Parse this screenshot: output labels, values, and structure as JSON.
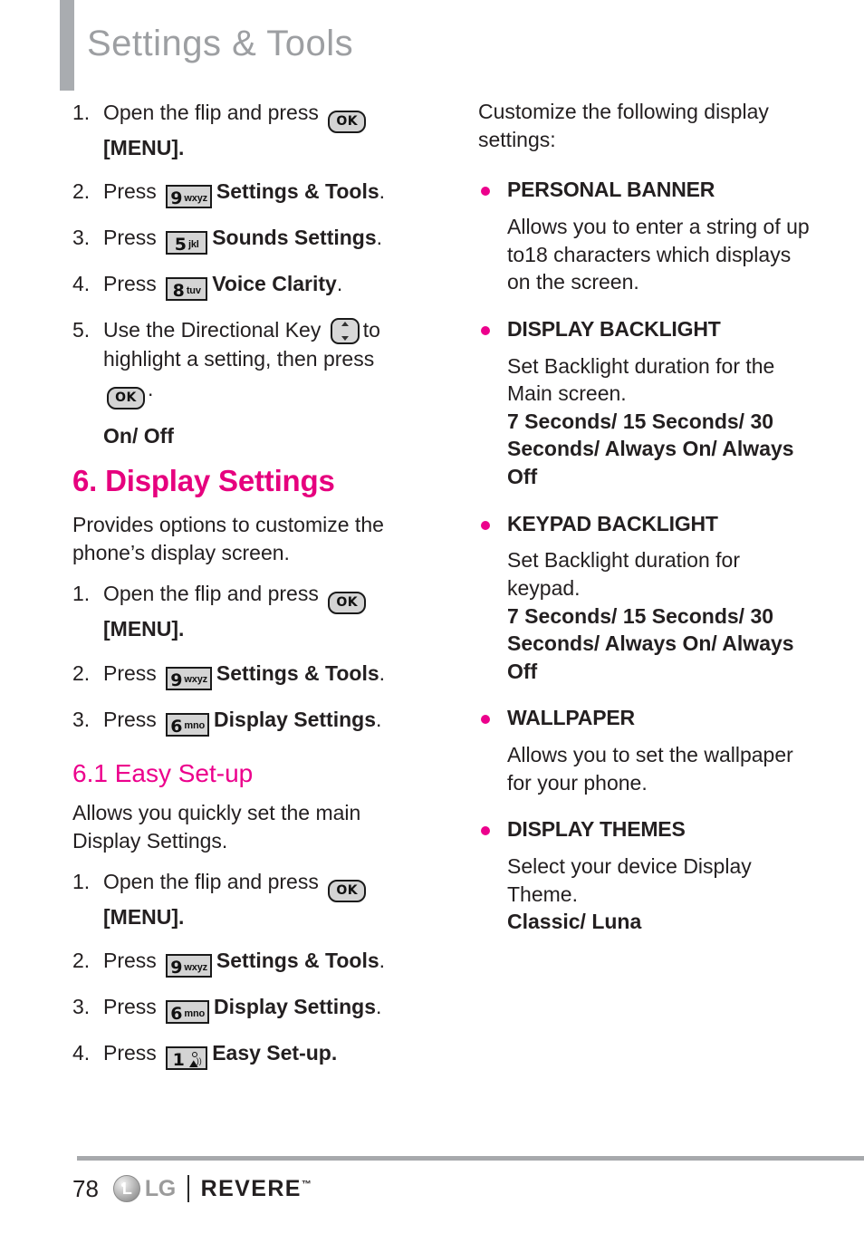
{
  "header": {
    "title": "Settings & Tools"
  },
  "left_column": {
    "voice_clarity_steps": [
      {
        "num": "1.",
        "text_before": "Open the flip and press",
        "key": "ok",
        "text_after": "[MENU]."
      },
      {
        "num": "2.",
        "text_before": "Press",
        "key": "9",
        "key_letters": "wxyz",
        "bold_after": "Settings & Tools",
        "text_after": "."
      },
      {
        "num": "3.",
        "text_before": "Press",
        "key": "5",
        "key_letters": "jkl",
        "bold_after": "Sounds Settings",
        "text_after": "."
      },
      {
        "num": "4.",
        "text_before": "Press",
        "key": "8",
        "key_letters": "tuv",
        "bold_after": "Voice Clarity",
        "text_after": "."
      },
      {
        "num": "5.",
        "text_before": "Use the Directional Key",
        "key": "dir",
        "text_after": "to highlight a setting, then press",
        "key2": "ok",
        "text_end": "."
      }
    ],
    "voice_clarity_options": "On/ Off",
    "section_heading": "6. Display Settings",
    "section_intro": "Provides options to customize the phone’s display screen.",
    "display_settings_steps": [
      {
        "num": "1.",
        "text_before": "Open the flip and press",
        "key": "ok",
        "text_after": "[MENU]."
      },
      {
        "num": "2.",
        "text_before": "Press",
        "key": "9",
        "key_letters": "wxyz",
        "bold_after": "Settings & Tools",
        "text_after": "."
      },
      {
        "num": "3.",
        "text_before": "Press",
        "key": "6",
        "key_letters": "mno",
        "bold_after": "Display Settings",
        "text_after": "."
      }
    ],
    "subsection_heading": "6.1 Easy Set-up",
    "subsection_intro": "Allows you quickly set the main Display Settings.",
    "easy_setup_steps": [
      {
        "num": "1.",
        "text_before": "Open the flip and press",
        "key": "ok",
        "text_after": "[MENU]."
      },
      {
        "num": "2.",
        "text_before": "Press",
        "key": "9",
        "key_letters": "wxyz",
        "bold_after": "Settings & Tools",
        "text_after": "."
      },
      {
        "num": "3.",
        "text_before": "Press",
        "key": "6",
        "key_letters": "mno",
        "bold_after": "Display Settings",
        "text_after": "."
      },
      {
        "num": "4.",
        "text_before": "Press",
        "key": "1",
        "key_letters": "voicemail",
        "bold_after": "Easy Set-up.",
        "text_after": ""
      }
    ]
  },
  "right_column": {
    "intro": "Customize the following display settings:",
    "items": [
      {
        "title": "PERSONAL BANNER",
        "body": "Allows you to enter a string of up to18 characters which displays on the screen.",
        "options": ""
      },
      {
        "title": "DISPLAY BACKLIGHT",
        "body": "Set Backlight duration for the Main screen.",
        "options": "7 Seconds/ 15 Seconds/ 30 Seconds/ Always On/ Always Off"
      },
      {
        "title": "KEYPAD BACKLIGHT",
        "body": "Set Backlight duration for keypad.",
        "options": "7 Seconds/ 15 Seconds/ 30 Seconds/ Always On/ Always Off"
      },
      {
        "title": "WALLPAPER",
        "body": "Allows you to set the wallpaper for your phone.",
        "options": ""
      },
      {
        "title": "DISPLAY THEMES",
        "body": "Select your device Display Theme.",
        "options": "Classic/ Luna"
      }
    ]
  },
  "footer": {
    "page_number": "78",
    "brand": "LG",
    "product": "REVERE",
    "trademark": "™"
  },
  "colors": {
    "magenta": "#EC008C",
    "heading_gray": "#9D9FA2",
    "bar_gray": "#A9ACB0",
    "text": "#231F20"
  },
  "labels": {
    "step1_step_text": "1. Open the flip and press",
    "menu_label": "[MENU].",
    "press_label": "Press",
    "keys": {
      "ok": "OK",
      "nine": "9",
      "nine_letters": "wxyz",
      "five": "5",
      "five_letters": "jkl",
      "eight": "8",
      "eight_letters": "tuv",
      "six": "6",
      "six_letters": "mno",
      "one": "1"
    }
  }
}
